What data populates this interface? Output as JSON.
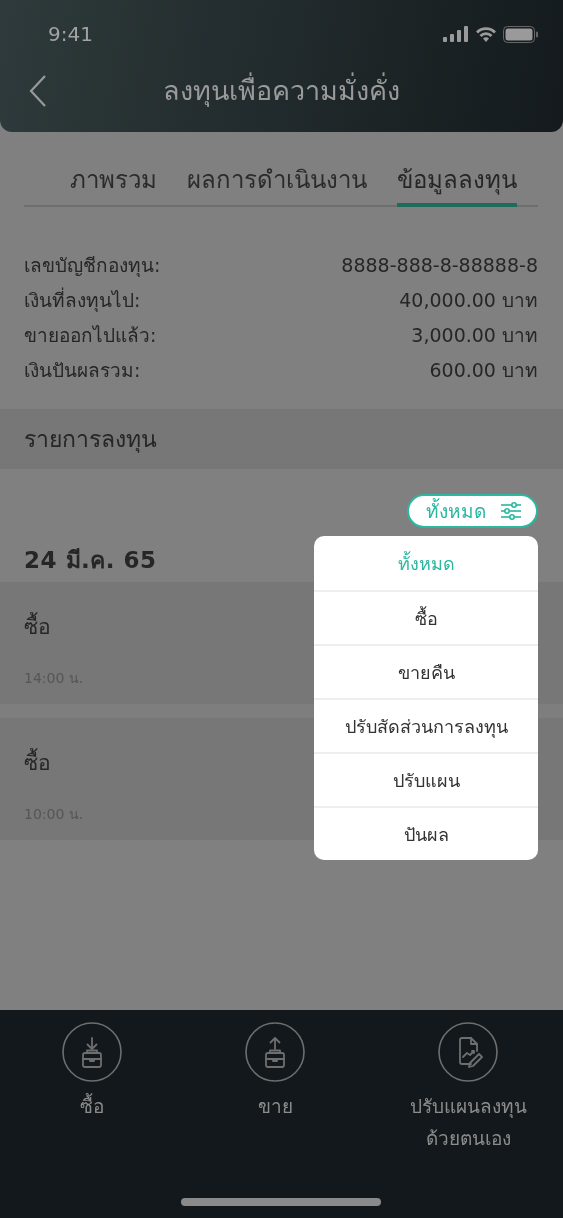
{
  "status_bar": {
    "time": "9:41"
  },
  "header": {
    "title": "ลงทุนเพื่อความมั่งคั่ง"
  },
  "tabs": [
    {
      "label": "ภาพรวม",
      "selected": false
    },
    {
      "label": "ผลการดำเนินงาน",
      "selected": false
    },
    {
      "label": "ข้อมูลลงทุน",
      "selected": true
    }
  ],
  "account_info": [
    {
      "label": "เลขบัญชีกองทุน:",
      "value": "8888-888-8-88888-8"
    },
    {
      "label": "เงินที่ลงทุนไป:",
      "value": "40,000.00 บาท"
    },
    {
      "label": "ขายออกไปแล้ว:",
      "value": "3,000.00 บาท"
    },
    {
      "label": "เงินปันผลรวม:",
      "value": "600.00 บาท"
    }
  ],
  "transactions_section": {
    "title": "รายการลงทุน",
    "filter": {
      "label": "ทั้งหมด"
    },
    "date": "24 มี.ค. 65",
    "items": [
      {
        "type": "ซื้อ",
        "time": "14:00 น."
      },
      {
        "type": "ซื้อ",
        "time": "10:00 น."
      }
    ]
  },
  "filter_menu": [
    {
      "label": "ทั้งหมด",
      "selected": true
    },
    {
      "label": "ซื้อ",
      "selected": false
    },
    {
      "label": "ขายคืน",
      "selected": false
    },
    {
      "label": "ปรับสัดส่วนการลงทุน",
      "selected": false
    },
    {
      "label": "ปรับแผน",
      "selected": false
    },
    {
      "label": "ปันผล",
      "selected": false
    }
  ],
  "bottom_actions": [
    {
      "kind": "buy",
      "lines": [
        "ซื้อ"
      ]
    },
    {
      "kind": "sell",
      "lines": [
        "ขาย"
      ]
    },
    {
      "kind": "plan",
      "lines": [
        "ปรับแผนลงทุน",
        "ด้วยตนเอง"
      ]
    }
  ]
}
